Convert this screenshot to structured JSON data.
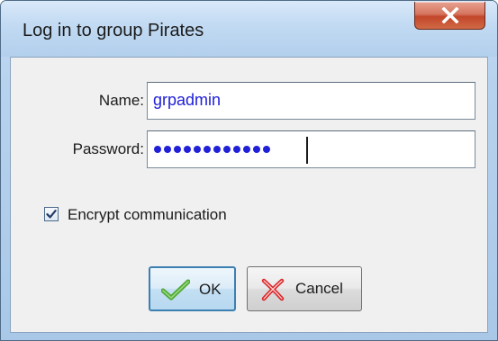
{
  "dialog": {
    "title": "Log in to group Pirates"
  },
  "form": {
    "name_label": "Name:",
    "name_value": "grpadmin",
    "password_label": "Password:",
    "password_length": 12
  },
  "options": {
    "encrypt_label": "Encrypt communication",
    "encrypt_checked": true
  },
  "buttons": {
    "ok_label": "OK",
    "cancel_label": "Cancel"
  },
  "icons": {
    "close": "close-icon",
    "ok": "checkmark-icon",
    "cancel": "x-mark-icon",
    "checkbox": "checkmark-icon"
  },
  "colors": {
    "field_text": "#2020d8",
    "close_button": "#c2462a",
    "ok_check": "#4faa34",
    "cancel_x": "#d8282a",
    "default_button_border": "#3c7fb1"
  }
}
